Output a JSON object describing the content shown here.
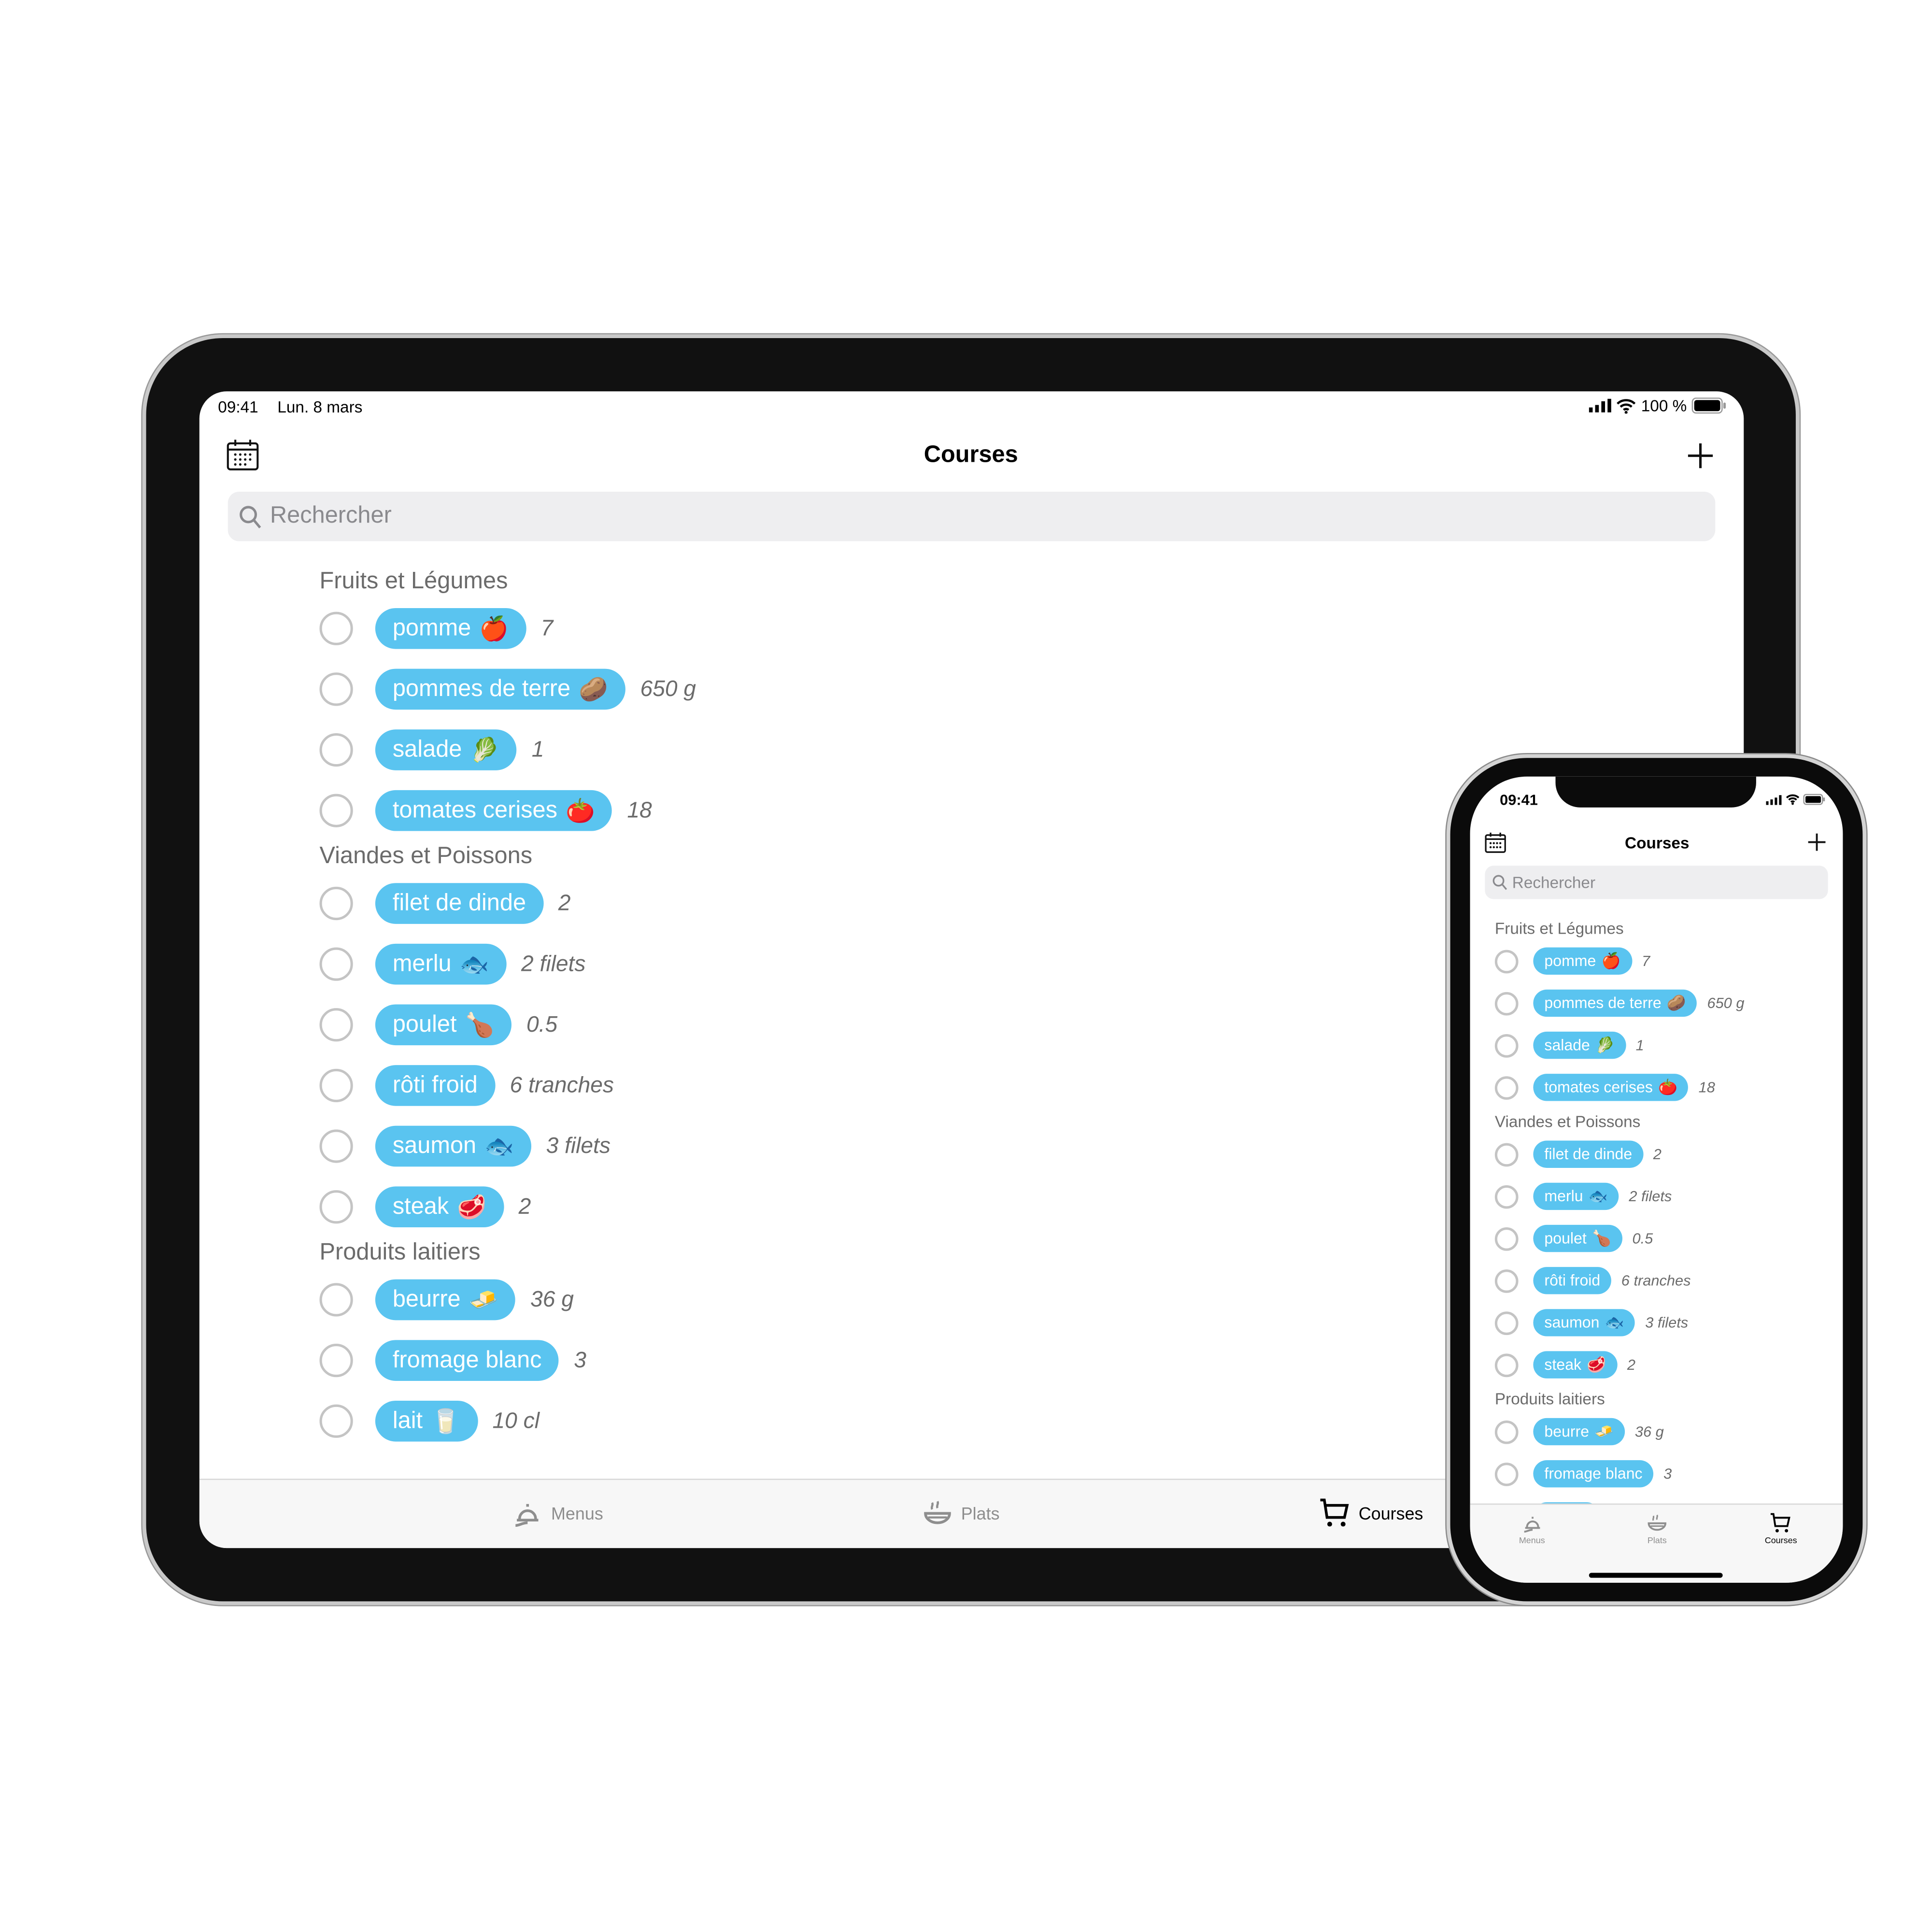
{
  "ipad": {
    "status": {
      "time": "09:41",
      "date": "Lun. 8 mars",
      "battery": "100 %"
    },
    "title": "Courses",
    "search_placeholder": "Rechercher",
    "tabs": [
      {
        "label": "Menus",
        "icon": "cloche-icon",
        "active": false
      },
      {
        "label": "Plats",
        "icon": "bowl-icon",
        "active": false
      },
      {
        "label": "Courses",
        "icon": "cart-icon",
        "active": true
      }
    ]
  },
  "iphone": {
    "status": {
      "time": "09:41"
    },
    "title": "Courses",
    "search_placeholder": "Rechercher",
    "tabs": [
      {
        "label": "Menus",
        "icon": "cloche-icon",
        "active": false
      },
      {
        "label": "Plats",
        "icon": "bowl-icon",
        "active": false
      },
      {
        "label": "Courses",
        "icon": "cart-icon",
        "active": true
      }
    ]
  },
  "colors": {
    "pill": "#5ac4f0",
    "accent_text": "#000000",
    "inactive_tab": "#8e8e8e"
  },
  "sections": [
    {
      "title": "Fruits et Légumes",
      "items": [
        {
          "name": "pomme",
          "emoji": "🍎",
          "qty": "7"
        },
        {
          "name": "pommes de terre",
          "emoji": "🥔",
          "qty": "650 g"
        },
        {
          "name": "salade",
          "emoji": "🥬",
          "qty": "1"
        },
        {
          "name": "tomates cerises",
          "emoji": "🍅",
          "qty": "18"
        }
      ]
    },
    {
      "title": "Viandes et Poissons",
      "items": [
        {
          "name": "filet de dinde",
          "emoji": "",
          "qty": "2"
        },
        {
          "name": "merlu",
          "emoji": "🐟",
          "qty": "2 filets"
        },
        {
          "name": "poulet",
          "emoji": "🍗",
          "qty": "0.5"
        },
        {
          "name": "rôti froid",
          "emoji": "",
          "qty": "6 tranches"
        },
        {
          "name": "saumon",
          "emoji": "🐟",
          "qty": "3 filets"
        },
        {
          "name": "steak",
          "emoji": "🥩",
          "qty": "2"
        }
      ]
    },
    {
      "title": "Produits laitiers",
      "items": [
        {
          "name": "beurre",
          "emoji": "🧈",
          "qty": "36 g"
        },
        {
          "name": "fromage blanc",
          "emoji": "",
          "qty": "3"
        },
        {
          "name": "lait",
          "emoji": "🥛",
          "qty": "10 cl"
        }
      ]
    }
  ]
}
